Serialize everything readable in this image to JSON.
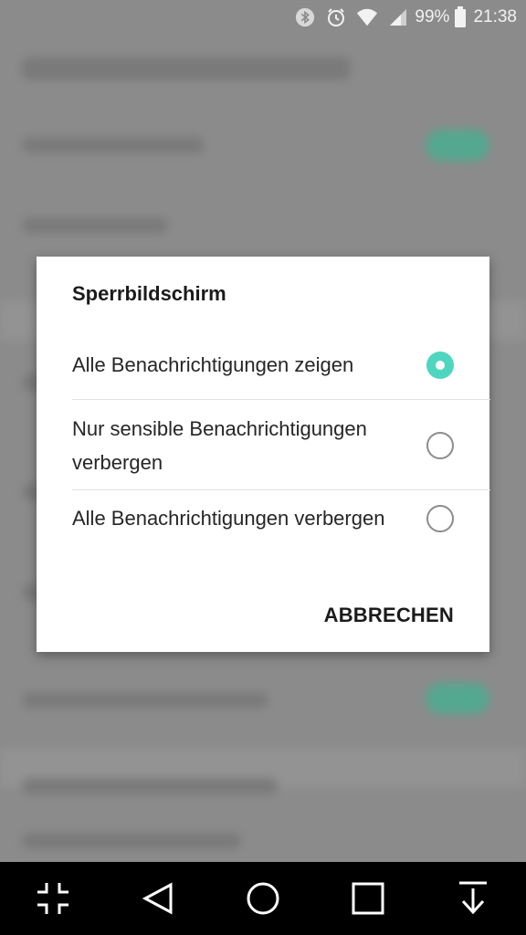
{
  "status_bar": {
    "battery_percent": "99%",
    "time": "21:38",
    "icons": [
      "bluetooth-icon",
      "alarm-icon",
      "wifi-icon",
      "signal-icon",
      "battery-icon"
    ]
  },
  "dialog": {
    "title": "Sperrbildschirm",
    "options": [
      {
        "label": "Alle Benachrichtigungen zeigen",
        "selected": true
      },
      {
        "label": "Nur sensible Benachrichtigungen verbergen",
        "selected": false
      },
      {
        "label": "Alle Benachrichtigungen verbergen",
        "selected": false
      }
    ],
    "cancel_label": "ABBRECHEN"
  },
  "nav_bar": {
    "buttons": [
      "compress-icon",
      "back-icon",
      "home-icon",
      "recents-icon",
      "notification-pull-icon"
    ]
  },
  "colors": {
    "accent": "#4fd6bf",
    "background_dim": "#8c8c8c",
    "dialog_bg": "#ffffff"
  }
}
